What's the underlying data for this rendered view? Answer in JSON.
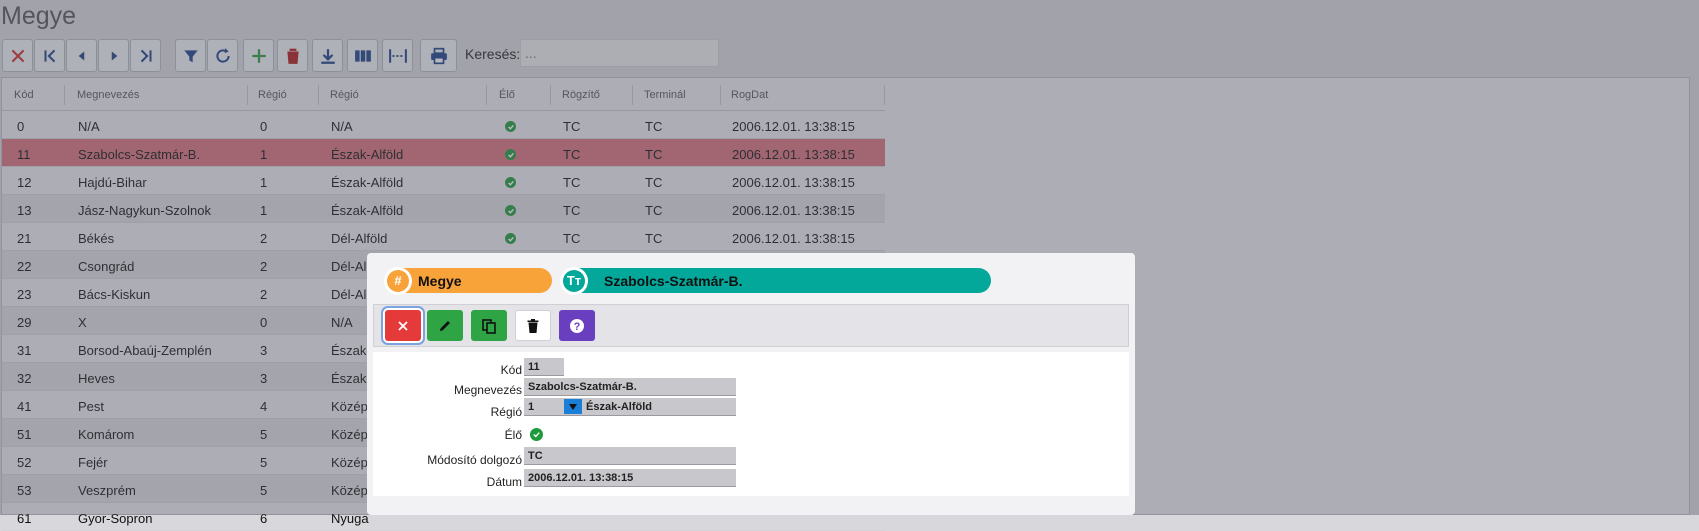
{
  "page": {
    "title": "Megye"
  },
  "toolbar": {
    "buttons": [
      {
        "name": "close-button",
        "icon": "x-icon"
      },
      {
        "name": "first-record-button",
        "icon": "first-page-icon"
      },
      {
        "name": "prev-record-button",
        "icon": "caret-left-icon"
      },
      {
        "name": "next-record-button",
        "icon": "caret-right-icon"
      },
      {
        "name": "last-record-button",
        "icon": "last-page-icon"
      },
      {
        "name": "filter-button",
        "icon": "filter-icon"
      },
      {
        "name": "refresh-button",
        "icon": "refresh-icon"
      },
      {
        "name": "add-button",
        "icon": "plus-icon"
      },
      {
        "name": "delete-button",
        "icon": "trash-icon"
      },
      {
        "name": "download-button",
        "icon": "download-icon"
      },
      {
        "name": "columns-button",
        "icon": "columns-icon"
      },
      {
        "name": "column-width-button",
        "icon": "width-icon"
      },
      {
        "name": "print-button",
        "icon": "print-icon"
      }
    ],
    "search_label": "Keresés:",
    "search_placeholder": "..."
  },
  "table": {
    "headers": {
      "kod": "Kód",
      "megnevezes": "Megnevezés",
      "regio_kod": "Régió",
      "regio": "Régió",
      "elo": "Élő",
      "rogzito": "Rögzítő",
      "terminal": "Terminál",
      "rogdat": "RogDat"
    },
    "rows": [
      {
        "kod": "0",
        "megnevezes": "N/A",
        "regio_kod": "0",
        "regio": "N/A",
        "elo": true,
        "rogzito": "TC",
        "terminal": "TC",
        "rogdat": "2006.12.01. 13:38:15"
      },
      {
        "kod": "11",
        "megnevezes": "Szabolcs-Szatmár-B.",
        "regio_kod": "1",
        "regio": "Észak-Alföld",
        "elo": true,
        "rogzito": "TC",
        "terminal": "TC",
        "rogdat": "2006.12.01. 13:38:15"
      },
      {
        "kod": "12",
        "megnevezes": "Hajdú-Bihar",
        "regio_kod": "1",
        "regio": "Észak-Alföld",
        "elo": true,
        "rogzito": "TC",
        "terminal": "TC",
        "rogdat": "2006.12.01. 13:38:15"
      },
      {
        "kod": "13",
        "megnevezes": "Jász-Nagykun-Szolnok",
        "regio_kod": "1",
        "regio": "Észak-Alföld",
        "elo": true,
        "rogzito": "TC",
        "terminal": "TC",
        "rogdat": "2006.12.01. 13:38:15"
      },
      {
        "kod": "21",
        "megnevezes": "Békés",
        "regio_kod": "2",
        "regio": "Dél-Alföld",
        "elo": true,
        "rogzito": "TC",
        "terminal": "TC",
        "rogdat": "2006.12.01. 13:38:15"
      },
      {
        "kod": "22",
        "megnevezes": "Csongrád",
        "regio_kod": "2",
        "regio": "Dél-Al",
        "elo": null,
        "rogzito": "",
        "terminal": "",
        "rogdat": ""
      },
      {
        "kod": "23",
        "megnevezes": "Bács-Kiskun",
        "regio_kod": "2",
        "regio": "Dél-Al",
        "elo": null,
        "rogzito": "",
        "terminal": "",
        "rogdat": ""
      },
      {
        "kod": "29",
        "megnevezes": "X",
        "regio_kod": "0",
        "regio": "N/A",
        "elo": null,
        "rogzito": "",
        "terminal": "",
        "rogdat": ""
      },
      {
        "kod": "31",
        "megnevezes": "Borsod-Abaúj-Zemplén",
        "regio_kod": "3",
        "regio": "Észak-",
        "elo": null,
        "rogzito": "",
        "terminal": "",
        "rogdat": ""
      },
      {
        "kod": "32",
        "megnevezes": "Heves",
        "regio_kod": "3",
        "regio": "Észak-",
        "elo": null,
        "rogzito": "",
        "terminal": "",
        "rogdat": ""
      },
      {
        "kod": "41",
        "megnevezes": "Pest",
        "regio_kod": "4",
        "regio": "Közép",
        "elo": null,
        "rogzito": "",
        "terminal": "",
        "rogdat": ""
      },
      {
        "kod": "51",
        "megnevezes": "Komárom",
        "regio_kod": "5",
        "regio": "Közép",
        "elo": null,
        "rogzito": "",
        "terminal": "",
        "rogdat": ""
      },
      {
        "kod": "52",
        "megnevezes": "Fejér",
        "regio_kod": "5",
        "regio": "Közép",
        "elo": null,
        "rogzito": "",
        "terminal": "",
        "rogdat": ""
      },
      {
        "kod": "53",
        "megnevezes": "Veszprém",
        "regio_kod": "5",
        "regio": "Közép",
        "elo": null,
        "rogzito": "",
        "terminal": "",
        "rogdat": ""
      },
      {
        "kod": "61",
        "megnevezes": "Gyor-Sopron",
        "regio_kod": "6",
        "regio": "Nyuga",
        "elo": null,
        "rogzito": "",
        "terminal": "",
        "rogdat": ""
      }
    ]
  },
  "modal": {
    "entity_tag": "Megye",
    "entity_icon": "hash-icon",
    "record_tag": "Szabolcs-Szatmár-B.",
    "record_icon": "text-icon",
    "actions": [
      {
        "name": "cancel-button",
        "icon": "x-icon",
        "style": "red"
      },
      {
        "name": "edit-button",
        "icon": "pencil-icon",
        "style": "green"
      },
      {
        "name": "copy-button",
        "icon": "copy-icon",
        "style": "green"
      },
      {
        "name": "delete-button",
        "icon": "trash-icon",
        "style": "white"
      },
      {
        "name": "help-button",
        "icon": "question-icon",
        "style": "purple"
      }
    ],
    "form": {
      "kod_label": "Kód",
      "kod_value": "11",
      "megnevezes_label": "Megnevezés",
      "megnevezes_value": "Szabolcs-Szatmár-B.",
      "regio_label": "Régió",
      "regio_code": "1",
      "regio_name": "Észak-Alföld",
      "elo_label": "Élő",
      "elo_value": true,
      "modosito_label": "Módosító dolgozó",
      "modosito_value": "TC",
      "datum_label": "Dátum",
      "datum_value": "2006.12.01. 13:38:15"
    }
  },
  "colors": {
    "selected_row": "#d9707c",
    "ok_green": "#1e9a3c",
    "tag_orange": "#f8a23a",
    "tag_teal": "#04a89b"
  }
}
